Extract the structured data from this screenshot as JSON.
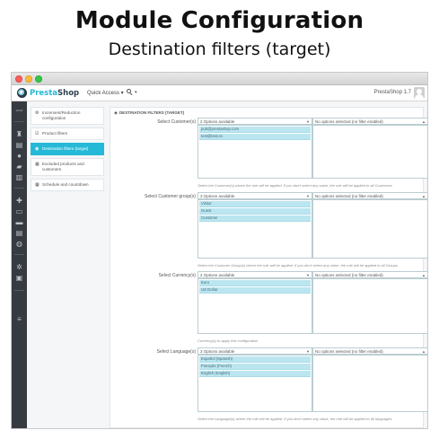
{
  "heading": {
    "title": "Module Configuration",
    "subtitle": "Destination filters (target)"
  },
  "topbar": {
    "brand_pre": "Presta",
    "brand_post": "Shop",
    "quick_access": "Quick Access ▾",
    "search_caret": "▾",
    "version": "PrestaShop 1.7"
  },
  "submenu": [
    {
      "icon": "⚙",
      "label": "Increment/Reduction configuration",
      "active": false
    },
    {
      "icon": "☑",
      "label": "Product filters",
      "active": false
    },
    {
      "icon": "◉",
      "label": "Destination filters (target)",
      "active": true
    },
    {
      "icon": "▦",
      "label": "Excluded products and customers",
      "active": false
    },
    {
      "icon": "▦",
      "label": "Schedule and countdown",
      "active": false
    }
  ],
  "panel": {
    "icon": "◉",
    "title": "DESTINATION FILTERS (TARGET)"
  },
  "fields": [
    {
      "label": "Select Customer(s)",
      "available": "2 Options available",
      "selected": "No options selected (no filter enabled)",
      "options": [
        "pub@prestashop.com",
        "test@test.es"
      ],
      "help": "Select the Customer(s) where the rule will be applied. If you don't select any value, the rule will be applied to all Customers"
    },
    {
      "label": "Select Customer group(s)",
      "available": "3 Options available",
      "selected": "No options selected (no filter enabled)",
      "options": [
        "Visitor",
        "Guest",
        "Customer"
      ],
      "help": "Select the Customer Group(s) where the rule will be applied. If you don't select any value, the rule will be applied to all Groups."
    },
    {
      "label": "Select Currency(s)",
      "available": "2 Options available",
      "selected": "No options selected (no filter enabled)",
      "options": [
        "Euro",
        "US Dollar"
      ],
      "help": "Currency(s) to apply this configuration"
    },
    {
      "label": "Select Language(s)",
      "available": "3 Options available",
      "selected": "No options selected (no filter enabled)",
      "options": [
        "Español (Spanish)",
        "Français (French)",
        "English (English)"
      ],
      "help": "Select the Language(s) where the rule will be applied. If you don't select any value, the rule will be applied to all languages"
    }
  ],
  "colors": {
    "accent": "#25b9d7",
    "sidebar": "#363a41",
    "option_bg": "#bbe6f0"
  }
}
